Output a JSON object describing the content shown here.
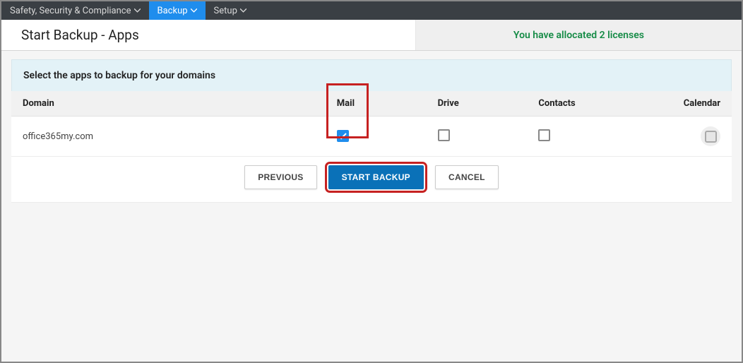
{
  "nav": {
    "items": [
      {
        "label": "Safety, Security & Compliance",
        "active": false
      },
      {
        "label": "Backup",
        "active": true
      },
      {
        "label": "Setup",
        "active": false
      }
    ]
  },
  "header": {
    "title": "Start Backup - Apps",
    "license_text": "You have allocated 2 licenses"
  },
  "panel": {
    "instruction": "Select the apps to backup for your domains"
  },
  "table": {
    "columns": {
      "domain": "Domain",
      "mail": "Mail",
      "drive": "Drive",
      "contacts": "Contacts",
      "calendar": "Calendar"
    },
    "rows": [
      {
        "domain": "office365my.com",
        "mail": true,
        "drive": false,
        "contacts": false,
        "calendar": "disabled"
      }
    ]
  },
  "buttons": {
    "previous": "PREVIOUS",
    "start": "START BACKUP",
    "cancel": "CANCEL"
  }
}
